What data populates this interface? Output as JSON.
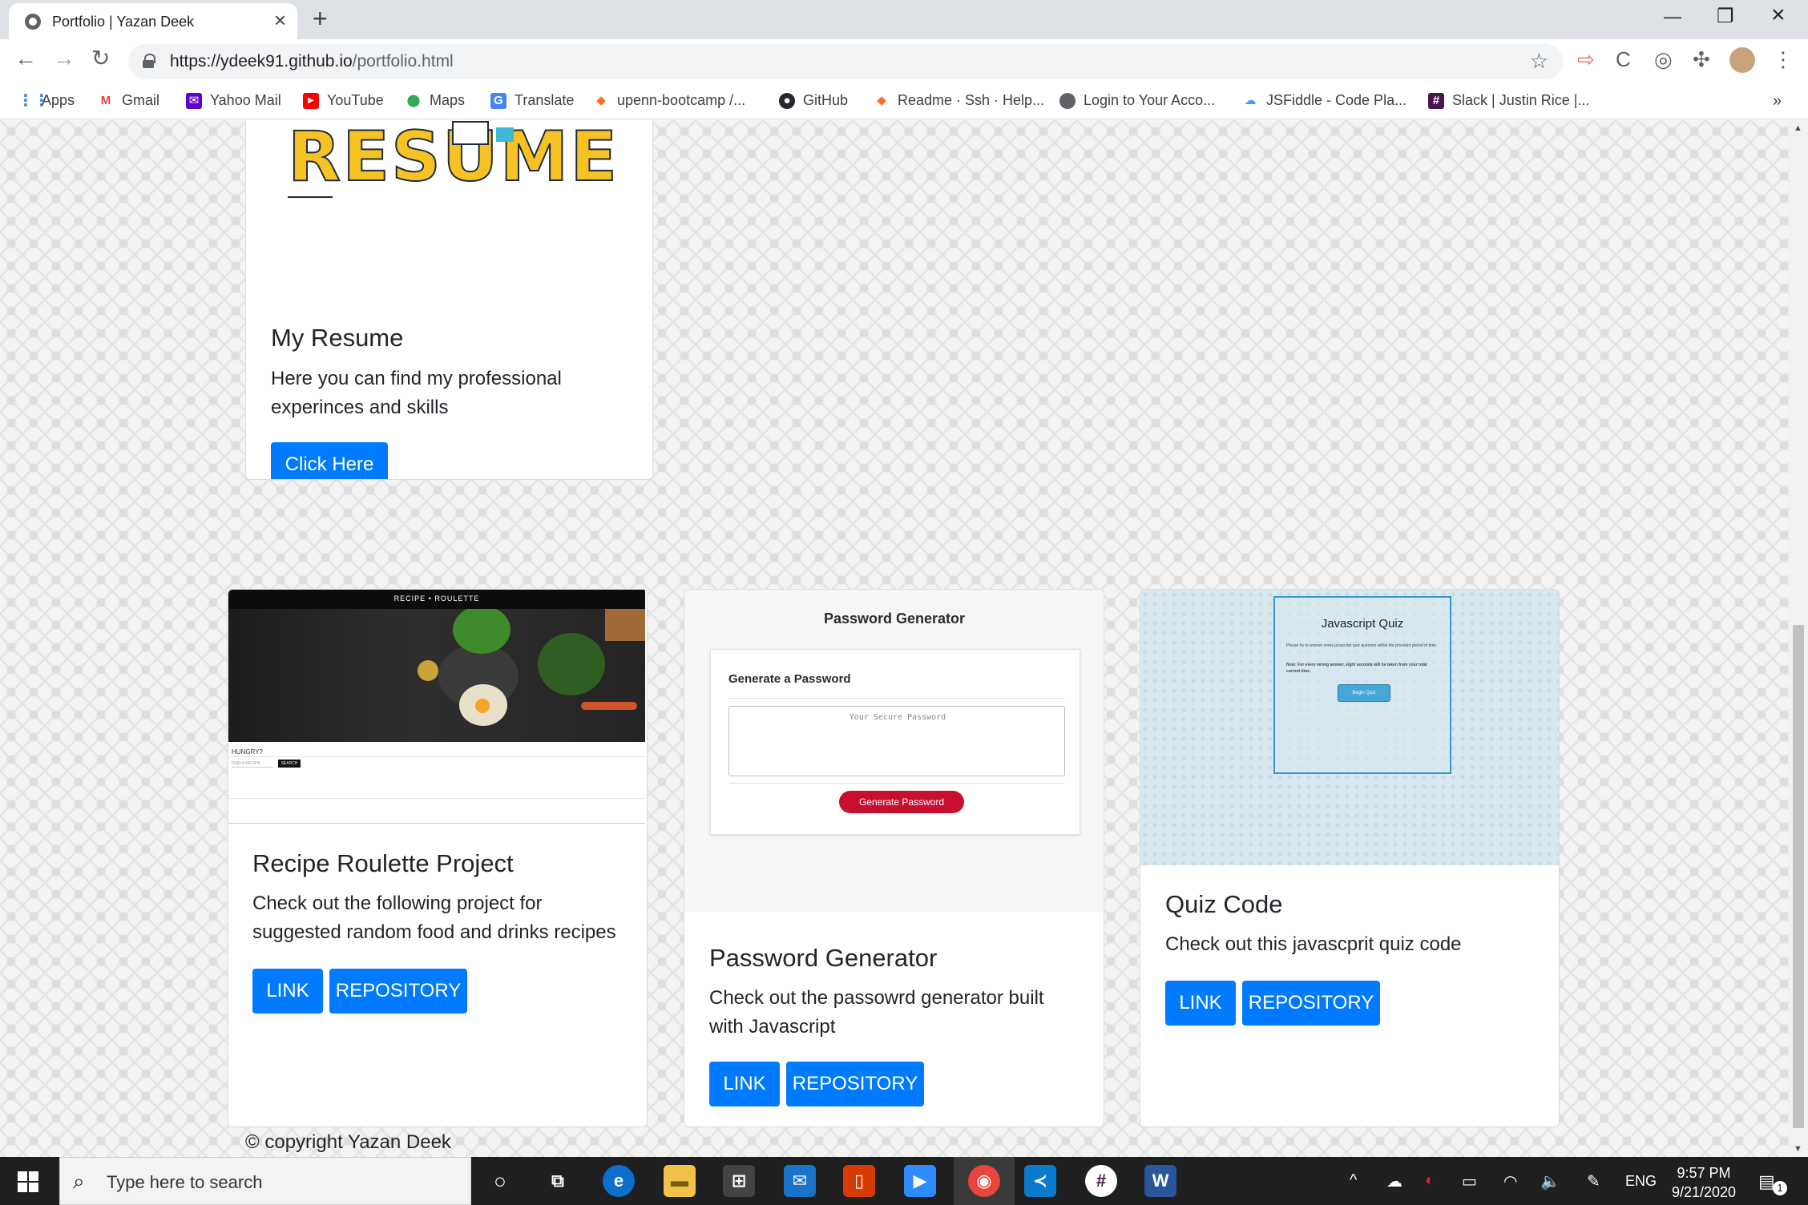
{
  "browser": {
    "tab_title": "Portfolio | Yazan Deek",
    "url_host": "https://ydeek91.github.io",
    "url_path": "/portfolio.html",
    "bookmarks": [
      {
        "label": "Apps",
        "icon": "apps-grid-icon",
        "color": "#4285f4"
      },
      {
        "label": "Gmail",
        "icon": "gmail-icon",
        "color": "#ea4335"
      },
      {
        "label": "Yahoo Mail",
        "icon": "yahoo-mail-icon",
        "color": "#6001d2"
      },
      {
        "label": "YouTube",
        "icon": "youtube-icon",
        "color": "#ff0000"
      },
      {
        "label": "Maps",
        "icon": "maps-pin-icon",
        "color": "#34a853"
      },
      {
        "label": "Translate",
        "icon": "translate-icon",
        "color": "#4285f4"
      },
      {
        "label": "upenn-bootcamp /...",
        "icon": "gitlab-icon",
        "color": "#fc6d26"
      },
      {
        "label": "GitHub",
        "icon": "github-icon",
        "color": "#24292e"
      },
      {
        "label": "Readme · Ssh · Help...",
        "icon": "gitlab-icon",
        "color": "#fc6d26"
      },
      {
        "label": "Login to Your Acco...",
        "icon": "globe-icon",
        "color": "#5f6368"
      },
      {
        "label": "JSFiddle - Code Pla...",
        "icon": "cloud-icon",
        "color": "#4e9cf5"
      },
      {
        "label": "Slack | Justin Rice |...",
        "icon": "slack-icon",
        "color": "#4a154b"
      }
    ]
  },
  "resume_card": {
    "logo_text": "RESUME",
    "title": "My Resume",
    "text": "Here you can find my professional experinces and skills",
    "button": "Click Here"
  },
  "recipe_card": {
    "screenshot": {
      "header": "RECIPE • ROULETTE",
      "hungry": "HUNGRY?",
      "find": "FIND A RECIPE",
      "search": "SEARCH"
    },
    "title": "Recipe Roulette Project",
    "text": "Check out the following project for suggested random food and drinks recipes",
    "link": "LINK",
    "repo": "REPOSITORY"
  },
  "password_card": {
    "screenshot": {
      "heading": "Password Generator",
      "sub": "Generate a Password",
      "placeholder": "Your Secure Password",
      "button": "Generate Password"
    },
    "title": "Password Generator",
    "text": "Check out the passowrd generator built with Javascript",
    "link": "LINK",
    "repo": "REPOSITORY"
  },
  "quiz_card": {
    "screenshot": {
      "heading": "Javascript Quiz",
      "line1": "Please try to answer every javascript quiz question within the provided period of time.",
      "line2": "Note: For every wrong answer, eight seconds will be taken from your total current time.",
      "button": "Begin Quiz"
    },
    "title": "Quiz Code",
    "text": "Check out this javascprit quiz code",
    "link": "LINK",
    "repo": "REPOSITORY"
  },
  "footer": "© copyright Yazan Deek",
  "taskbar": {
    "search_placeholder": "Type here to search",
    "lang": "ENG",
    "time": "9:57 PM",
    "date": "9/21/2020",
    "notifications": "1"
  }
}
